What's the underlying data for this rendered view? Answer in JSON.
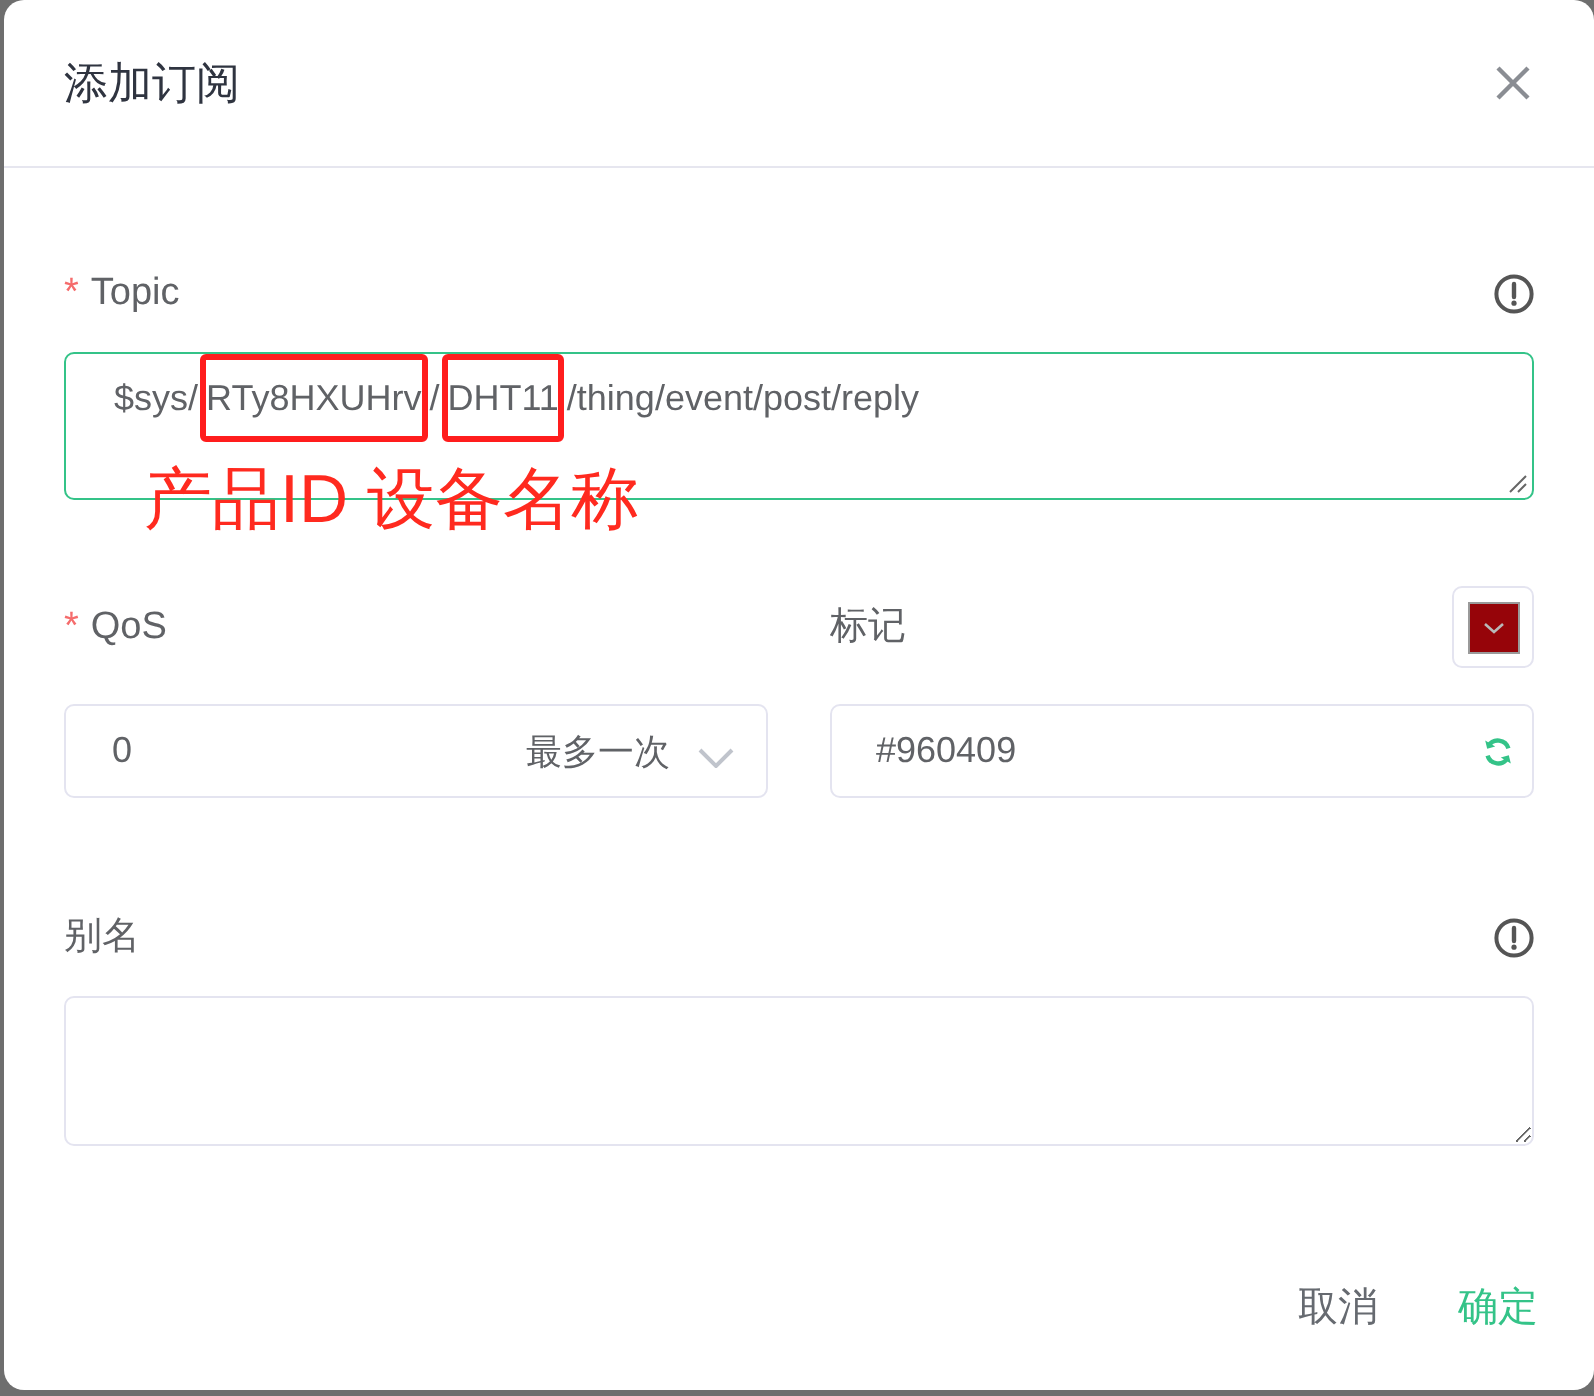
{
  "dialog": {
    "title": "添加订阅"
  },
  "topic": {
    "required_mark": "*",
    "label": "Topic",
    "focused": true,
    "segments": [
      {
        "text": "$sys/",
        "kind": "plain"
      },
      {
        "text": "RTy8HXUHrv",
        "kind": "boxed"
      },
      {
        "text": "/",
        "kind": "plain"
      },
      {
        "text": "DHT11",
        "kind": "boxed"
      },
      {
        "text": "/thing/event/post/reply",
        "kind": "plain"
      }
    ]
  },
  "annotation": {
    "text": "产品ID 设备名称"
  },
  "qos": {
    "required_mark": "*",
    "label": "QoS",
    "focused": false,
    "value": "0",
    "description": "最多一次"
  },
  "mark": {
    "label": "标记",
    "focused": false,
    "value": "#960409"
  },
  "alias": {
    "label": "别名",
    "focused": false
  },
  "buttons": [
    {
      "label": "取消",
      "kind": "cancel"
    },
    {
      "label": "确定",
      "kind": "confirm"
    }
  ]
}
